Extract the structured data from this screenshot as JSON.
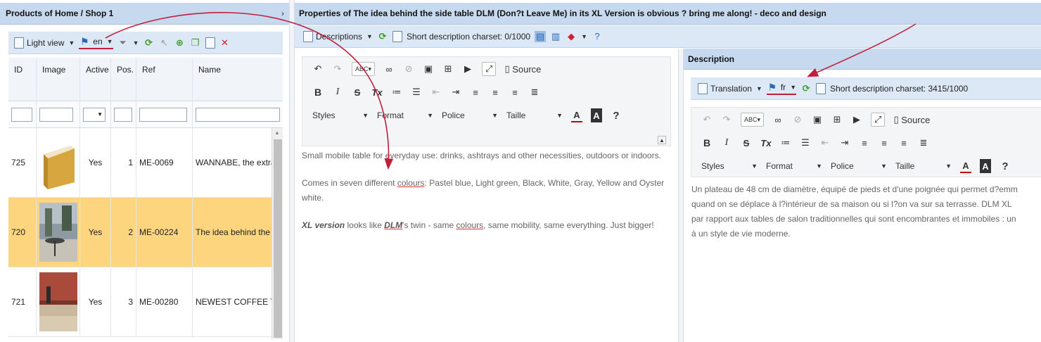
{
  "left_panel": {
    "title": "Products of Home / Shop 1",
    "toolbar": {
      "view_label": "Light view",
      "lang_label": "en"
    },
    "columns": [
      "ID",
      "Image",
      "Active",
      "Pos.",
      "Ref",
      "Name"
    ],
    "filter_active_value": "▼",
    "rows": [
      {
        "id": "725",
        "active": "Yes",
        "pos": "1",
        "ref": "ME-0069",
        "name": "WANNABE, the extra"
      },
      {
        "id": "720",
        "active": "Yes",
        "pos": "2",
        "ref": "ME-00224",
        "name": "The idea behind the"
      },
      {
        "id": "721",
        "active": "Yes",
        "pos": "3",
        "ref": "ME-00280",
        "name": "NEWEST COFFEE TA"
      }
    ],
    "selected_row": 1
  },
  "right_panel": {
    "title": "Properties of The idea behind the side table DLM (Don?t Leave Me) in its XL Version is obvious ? bring me along! - deco and design",
    "toolbar": {
      "descriptions_label": "Descriptions",
      "charset_label": "Short description charset: 0/1000"
    }
  },
  "editor1": {
    "source_label": "Source",
    "combos": [
      "Styles",
      "Format",
      "Police",
      "Taille"
    ],
    "help": "?",
    "content": {
      "p1": "Small mobile table for everyday use: drinks, ashtrays and other necessities, outdoors or indoors.",
      "p2_a": "Comes in seven different ",
      "p2_u": "colours",
      "p2_b": ": Pastel blue, Light green, Black, White, Gray, Yellow and Oyster white.",
      "p3_a": "XL version",
      "p3_b": " looks like ",
      "p3_c": "DLM",
      "p3_d": "'s twin - same ",
      "p3_e": "colours",
      "p3_f": ", same mobility, same everything. Just bigger!"
    }
  },
  "description_panel": {
    "title": "Description",
    "toolbar": {
      "translation_label": "Translation",
      "lang_label": "fr",
      "charset_label": "Short description charset: 3415/1000"
    },
    "source_label": "Source",
    "combos": [
      "Styles",
      "Format",
      "Police",
      "Taille"
    ],
    "help": "?",
    "lines": [
      "Un plateau de 48 cm de diamètre, équipé de pieds et d'une poignée qui permet d?emm",
      "quand on se déplace à l?intérieur de sa maison ou si l?on va sur sa terrasse. DLM XL",
      "par rapport aux tables de salon traditionnelles qui sont encombrantes et immobiles : un",
      "à un style de vie moderne."
    ]
  },
  "colors": {
    "header_bg": "#c7d9ef",
    "toolbar_bg": "#dce8f6",
    "selected_row": "#fdd57f",
    "arrow": "#c0203c"
  }
}
